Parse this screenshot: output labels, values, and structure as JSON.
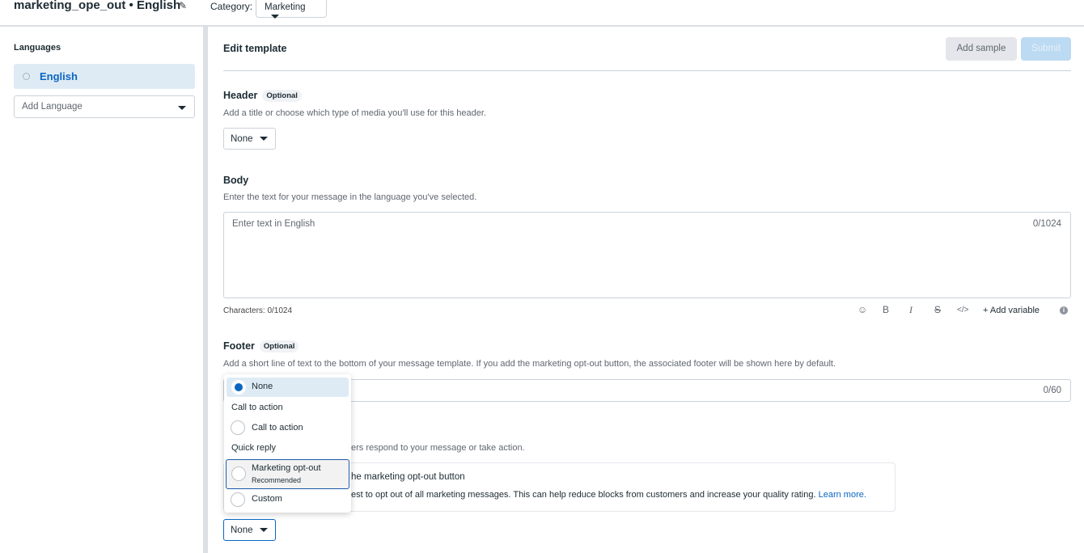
{
  "header": {
    "title": "marketing_ope_out • English",
    "category_label": "Category:",
    "category_value": "Marketing"
  },
  "sidebar": {
    "heading": "Languages",
    "languages": [
      {
        "label": "English",
        "selected": true
      }
    ],
    "add_language_placeholder": "Add Language"
  },
  "main": {
    "title": "Edit template",
    "add_sample": "Add sample",
    "submit": "Submit",
    "header_section": {
      "title": "Header",
      "badge": "Optional",
      "description": "Add a title or choose which type of media you'll use for this header.",
      "select_value": "None"
    },
    "body_section": {
      "title": "Body",
      "description": "Enter the text for your message in the language you've selected.",
      "placeholder": "Enter text in English",
      "counter": "0/1024",
      "characters": "Characters: 0/1024",
      "add_variable": "Add variable"
    },
    "footer_section": {
      "title": "Footer",
      "badge": "Optional",
      "description": "Add a short line of text to the bottom of your message template. If you add the marketing opt-out button, the associated footer will be shown here by default.",
      "counter": "0/60"
    },
    "buttons_section": {
      "description_visible": "ers respond to your message or take action.",
      "info_title_visible": "he marketing opt-out button",
      "info_text_visible": "est to opt out of all marketing messages. This can help reduce blocks from customers and increase your quality rating.",
      "learn_more": "Learn more.",
      "select_value": "None"
    },
    "dropdown": {
      "items": [
        {
          "label": "None",
          "selected": true
        },
        {
          "group": "Call to action"
        },
        {
          "label": "Call to action"
        },
        {
          "group": "Quick reply"
        },
        {
          "label": "Marketing opt-out",
          "sublabel": "Recommended",
          "focused": true
        },
        {
          "label": "Custom"
        }
      ]
    }
  },
  "colors": {
    "accent": "#0a66c2",
    "selected_bg": "#deebf5",
    "submit_disabled": "#bcdaf2"
  }
}
